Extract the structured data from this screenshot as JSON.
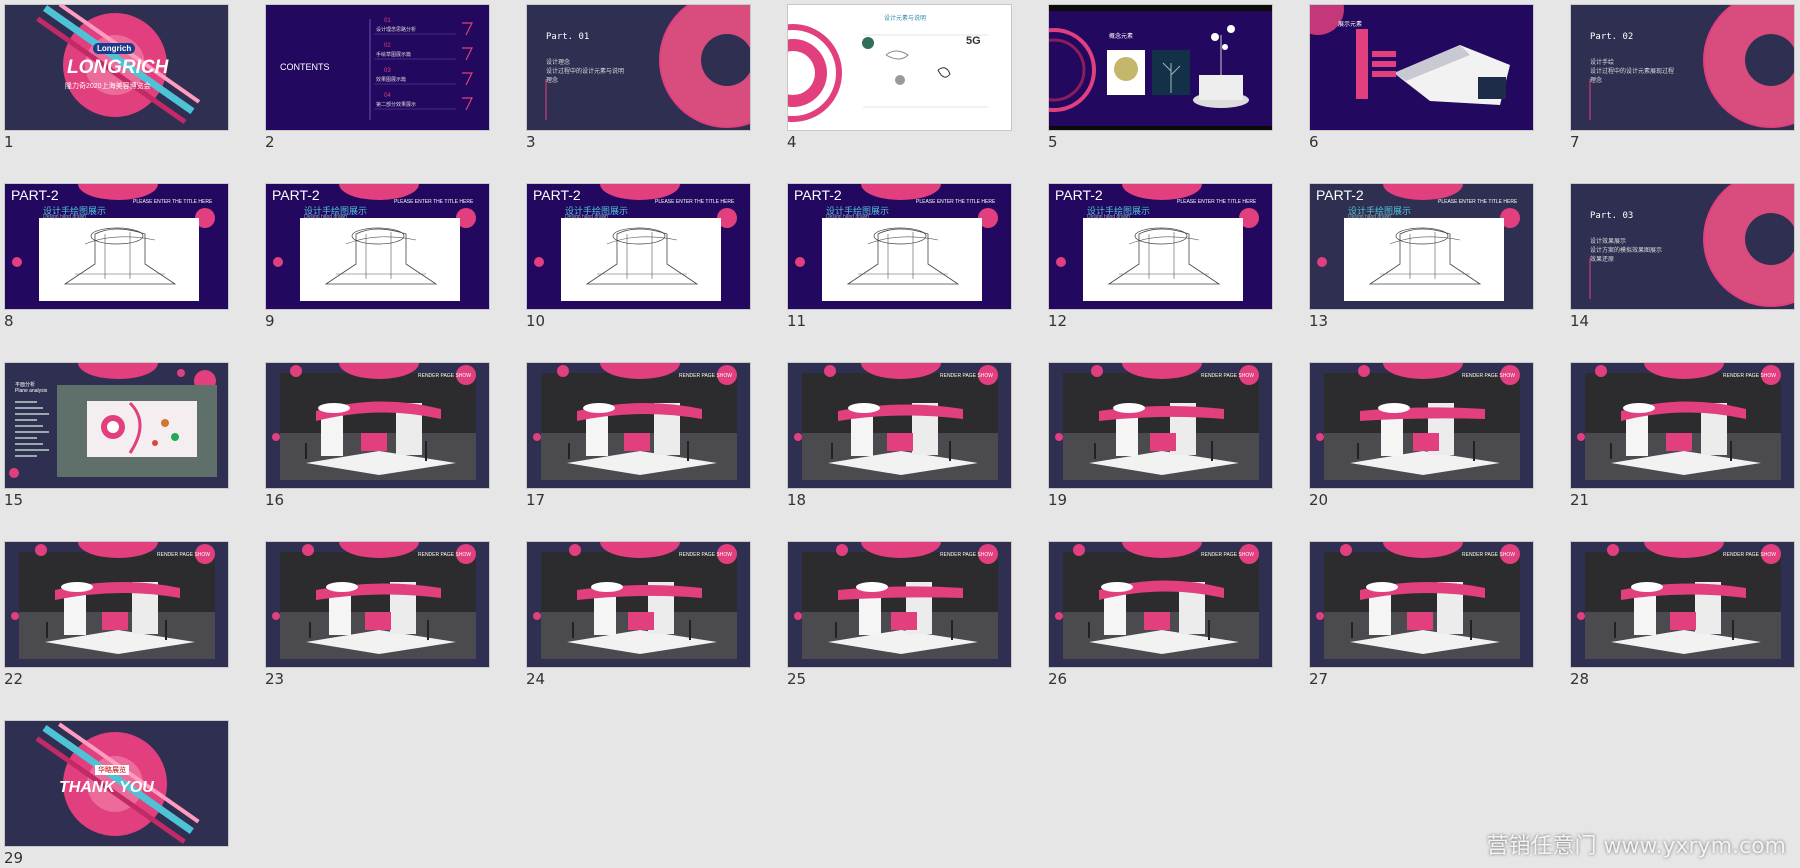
{
  "colors": {
    "navy": "#2f2f52",
    "purple": "#22095f",
    "pink": "#e13f7d",
    "cyan": "#4fc3d6",
    "white": "#ffffff",
    "floor": "#4b4b4f"
  },
  "slides": [
    {
      "num": "1",
      "kind": "cover",
      "brand": "Longrich",
      "title": "LONGRICH",
      "subtitle": "隆力奇2020上海美容博览会"
    },
    {
      "num": "2",
      "kind": "contents",
      "title": "CONTENTS",
      "items": [
        "01",
        "02",
        "03",
        "04"
      ],
      "lines": [
        "设计理念思路分析",
        "手绘草图展示篇",
        "效果图展示篇",
        "第二部分效果展示"
      ]
    },
    {
      "num": "3",
      "kind": "part",
      "part": "Part. 01",
      "lines": [
        "设计理念",
        "设计过程中的设计元素与说明",
        "理念"
      ]
    },
    {
      "num": "4",
      "kind": "white",
      "heading": "设计元素与说明",
      "badge": "5G"
    },
    {
      "num": "5",
      "kind": "dark",
      "heading": "概念元素"
    },
    {
      "num": "6",
      "kind": "dark",
      "heading": "展示元素"
    },
    {
      "num": "7",
      "kind": "part",
      "part": "Part. 02",
      "lines": [
        "设计手绘",
        "设计过程中的设计元素展现过程",
        "理念"
      ]
    },
    {
      "num": "8",
      "kind": "sketch",
      "title": "PART-2",
      "sub": "设计手绘图展示",
      "small": "Design hand drawn",
      "right": "PLEASE ENTER THE TITLE HERE"
    },
    {
      "num": "9",
      "kind": "sketch",
      "title": "PART-2",
      "sub": "设计手绘图展示",
      "small": "Design hand drawn",
      "right": "PLEASE ENTER THE TITLE HERE"
    },
    {
      "num": "10",
      "kind": "sketch",
      "title": "PART-2",
      "sub": "设计手绘图展示",
      "small": "Design hand drawn",
      "right": "PLEASE ENTER THE TITLE HERE"
    },
    {
      "num": "11",
      "kind": "sketch",
      "title": "PART-2",
      "sub": "设计手绘图展示",
      "small": "Design hand drawn",
      "right": "PLEASE ENTER THE TITLE HERE"
    },
    {
      "num": "12",
      "kind": "sketch",
      "title": "PART-2",
      "sub": "设计手绘图展示",
      "small": "Design hand drawn",
      "right": "PLEASE ENTER THE TITLE HERE"
    },
    {
      "num": "13",
      "kind": "sketch",
      "title": "PART-2",
      "sub": "设计手绘图展示",
      "small": "Design hand drawn",
      "right": "PLEASE ENTER THE TITLE HERE"
    },
    {
      "num": "14",
      "kind": "part",
      "part": "Part. 03",
      "lines": [
        "设计效果展示",
        "设计方案的模拟效果图展示",
        "效果还原"
      ]
    },
    {
      "num": "15",
      "kind": "plan",
      "heading": "平面分析",
      "sub": "Plane analysis"
    },
    {
      "num": "16",
      "kind": "render",
      "right": "RENDER PAGE SHOW"
    },
    {
      "num": "17",
      "kind": "render",
      "right": "RENDER PAGE SHOW"
    },
    {
      "num": "18",
      "kind": "render",
      "right": "RENDER PAGE SHOW"
    },
    {
      "num": "19",
      "kind": "render",
      "right": "RENDER PAGE SHOW"
    },
    {
      "num": "20",
      "kind": "render",
      "right": "RENDER PAGE SHOW"
    },
    {
      "num": "21",
      "kind": "render",
      "right": "RENDER PAGE SHOW"
    },
    {
      "num": "22",
      "kind": "render",
      "right": "RENDER PAGE SHOW"
    },
    {
      "num": "23",
      "kind": "render",
      "right": "RENDER PAGE SHOW"
    },
    {
      "num": "24",
      "kind": "render",
      "right": "RENDER PAGE SHOW"
    },
    {
      "num": "25",
      "kind": "render",
      "right": "RENDER PAGE SHOW"
    },
    {
      "num": "26",
      "kind": "render",
      "right": "RENDER PAGE SHOW"
    },
    {
      "num": "27",
      "kind": "render",
      "right": "RENDER PAGE SHOW"
    },
    {
      "num": "28",
      "kind": "render",
      "right": "RENDER PAGE SHOW"
    },
    {
      "num": "29",
      "kind": "thanks",
      "title": "THANK YOU",
      "brand": "华略展览"
    }
  ],
  "watermark": "营销任意门 www.yxrym.com"
}
